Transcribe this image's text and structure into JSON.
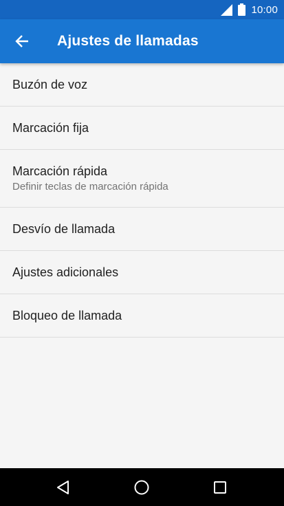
{
  "status_bar": {
    "time": "10:00",
    "icons": [
      "signal-icon",
      "battery-icon"
    ]
  },
  "app_bar": {
    "title": "Ajustes de llamadas",
    "back_icon": "arrow-back-icon"
  },
  "settings": {
    "items": [
      {
        "title": "Buzón de voz",
        "subtitle": ""
      },
      {
        "title": "Marcación fija",
        "subtitle": ""
      },
      {
        "title": "Marcación rápida",
        "subtitle": "Definir teclas de marcación rápida"
      },
      {
        "title": "Desvío de llamada",
        "subtitle": ""
      },
      {
        "title": "Ajustes adicionales",
        "subtitle": ""
      },
      {
        "title": "Bloqueo de llamada",
        "subtitle": ""
      }
    ]
  },
  "nav_bar": {
    "icons": [
      "nav-back-icon",
      "nav-home-icon",
      "nav-recents-icon"
    ]
  },
  "colors": {
    "status_bar": "#1565c0",
    "app_bar": "#1976d2",
    "background": "#f5f5f5",
    "divider": "#dcdcdc",
    "primary_text": "#212121",
    "secondary_text": "#737373",
    "nav_bar": "#000000"
  }
}
